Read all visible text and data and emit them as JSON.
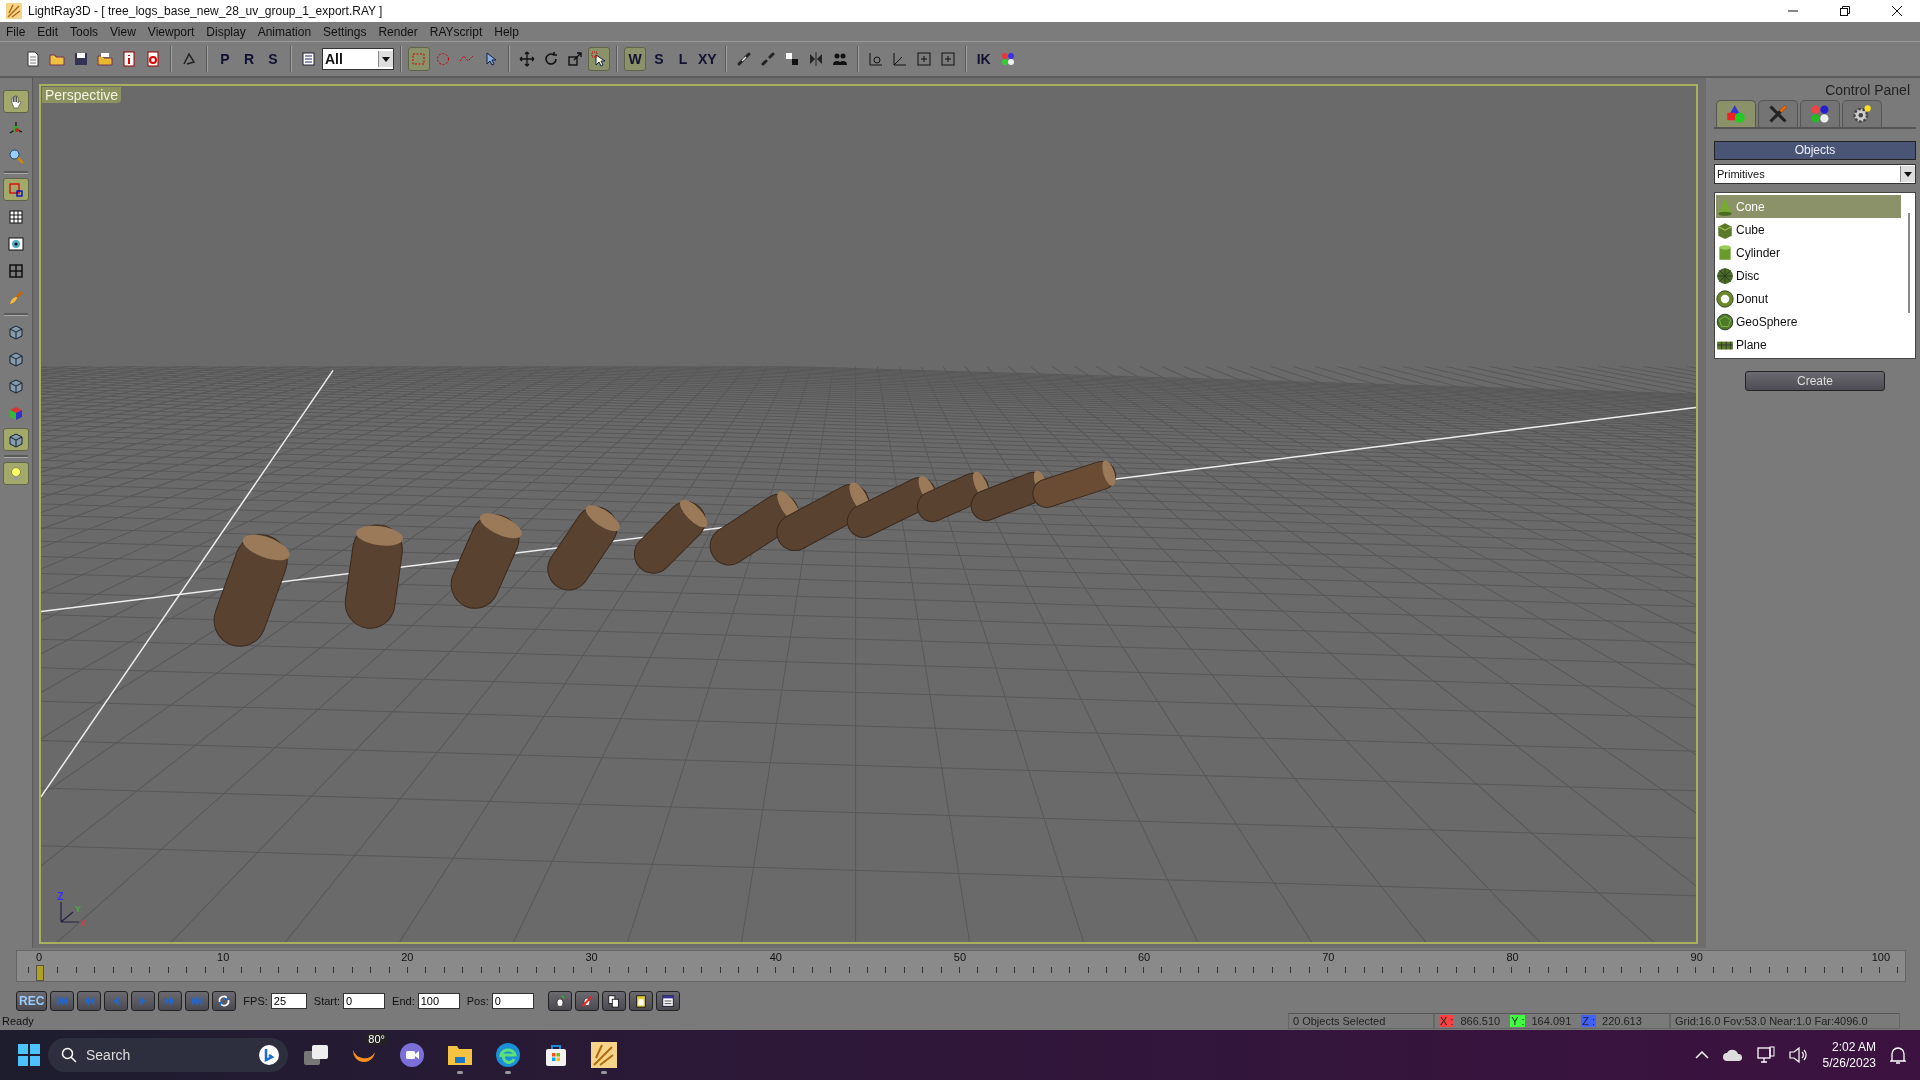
{
  "window": {
    "title": "LightRay3D - [ tree_logs_base_new_28_uv_group_1_export.RAY ]"
  },
  "menu": [
    "File",
    "Edit",
    "Tools",
    "View",
    "Viewport",
    "Display",
    "Animation",
    "Settings",
    "Render",
    "RAYscript",
    "Help"
  ],
  "toolbar": [
    {
      "kind": "new",
      "active": false
    },
    {
      "kind": "open",
      "active": false
    },
    {
      "kind": "save",
      "active": false
    },
    {
      "kind": "folder",
      "active": false
    },
    {
      "kind": "info",
      "active": false
    },
    {
      "kind": "export",
      "active": false
    },
    {
      "kind": "sep"
    },
    {
      "kind": "undo",
      "active": false
    },
    {
      "kind": "sep"
    },
    {
      "kind": "letter",
      "label": "P",
      "active": false
    },
    {
      "kind": "letter",
      "label": "R",
      "active": false
    },
    {
      "kind": "letter",
      "label": "S",
      "active": false
    },
    {
      "kind": "sep"
    },
    {
      "kind": "list",
      "active": false
    },
    {
      "kind": "dropdown",
      "value": "All"
    },
    {
      "kind": "sep"
    },
    {
      "kind": "rect-select",
      "active": true
    },
    {
      "kind": "circle-select",
      "active": false
    },
    {
      "kind": "fence-select",
      "active": false
    },
    {
      "kind": "pointer",
      "active": false
    },
    {
      "kind": "sep"
    },
    {
      "kind": "move",
      "active": false
    },
    {
      "kind": "rotate",
      "active": false
    },
    {
      "kind": "scale",
      "active": false
    },
    {
      "kind": "select-pointer",
      "active": true
    },
    {
      "kind": "sep"
    },
    {
      "kind": "letter",
      "label": "W",
      "active": true
    },
    {
      "kind": "letter",
      "label": "S",
      "active": false
    },
    {
      "kind": "letter",
      "label": "L",
      "active": false
    },
    {
      "kind": "letter",
      "label": "XY",
      "active": false
    },
    {
      "kind": "sep"
    },
    {
      "kind": "link",
      "active": false
    },
    {
      "kind": "unlink",
      "active": false
    },
    {
      "kind": "bind",
      "active": false
    },
    {
      "kind": "mirror",
      "active": false
    },
    {
      "kind": "group",
      "active": false
    },
    {
      "kind": "sep"
    },
    {
      "kind": "snap",
      "active": false
    },
    {
      "kind": "angle",
      "active": false
    },
    {
      "kind": "plus",
      "active": false
    },
    {
      "kind": "plus",
      "active": false
    },
    {
      "kind": "sep"
    },
    {
      "kind": "letter",
      "label": "IK",
      "active": false
    },
    {
      "kind": "colors",
      "active": false
    }
  ],
  "left_toolbar": [
    {
      "kind": "hand",
      "active": true
    },
    {
      "kind": "axes",
      "active": false
    },
    {
      "kind": "zoom",
      "active": false
    },
    {
      "kind": "sep"
    },
    {
      "kind": "region",
      "active": true
    },
    {
      "kind": "grid",
      "active": false
    },
    {
      "kind": "eye",
      "active": false
    },
    {
      "kind": "quad",
      "active": false
    },
    {
      "kind": "brush",
      "active": false
    },
    {
      "kind": "sep"
    },
    {
      "kind": "box",
      "active": false
    },
    {
      "kind": "box",
      "active": false
    },
    {
      "kind": "box",
      "active": false
    },
    {
      "kind": "rgb-box",
      "active": false
    },
    {
      "kind": "box",
      "active": true
    },
    {
      "kind": "sep"
    },
    {
      "kind": "bulb",
      "active": true
    }
  ],
  "viewport": {
    "label": "Perspective",
    "gizmo": [
      "Z",
      "Y",
      "X"
    ]
  },
  "control_panel": {
    "title": "Control Panel",
    "tabs": [
      {
        "kind": "create",
        "selected": true
      },
      {
        "kind": "modify",
        "selected": false
      },
      {
        "kind": "material",
        "selected": false
      },
      {
        "kind": "settings",
        "selected": false
      }
    ],
    "section": "Objects",
    "category": "Primitives",
    "objects": [
      {
        "kind": "cone",
        "label": "Cone",
        "selected": true
      },
      {
        "kind": "cube",
        "label": "Cube",
        "selected": false
      },
      {
        "kind": "cylinder",
        "label": "Cylinder",
        "selected": false
      },
      {
        "kind": "disc",
        "label": "Disc",
        "selected": false
      },
      {
        "kind": "donut",
        "label": "Donut",
        "selected": false
      },
      {
        "kind": "sphere",
        "label": "GeoSphere",
        "selected": false
      },
      {
        "kind": "plane",
        "label": "Plane",
        "selected": false
      }
    ],
    "create_button": "Create"
  },
  "timeline": {
    "ticks": [
      "0",
      "10",
      "20",
      "30",
      "40",
      "50",
      "60",
      "70",
      "80",
      "90",
      "100"
    ],
    "level": 0
  },
  "transport": {
    "buttons": [
      {
        "kind": "rec",
        "label": "REC"
      },
      {
        "kind": "first"
      },
      {
        "kind": "prev-key"
      },
      {
        "kind": "prev"
      },
      {
        "kind": "play"
      },
      {
        "kind": "next-key"
      },
      {
        "kind": "last"
      },
      {
        "kind": "loop"
      }
    ],
    "fields": [
      {
        "label": "FPS:",
        "value": "25"
      },
      {
        "label": "Start:",
        "value": "0"
      },
      {
        "label": "End:",
        "value": "100"
      },
      {
        "label": "Pos:",
        "value": "0"
      }
    ],
    "key_buttons": [
      {
        "kind": "add-key"
      },
      {
        "kind": "delete-key"
      },
      {
        "kind": "copy-key"
      },
      {
        "kind": "paste-key"
      },
      {
        "kind": "key-list"
      }
    ]
  },
  "status": {
    "message": "Ready",
    "selection": "0 Objects Selected",
    "coords": [
      {
        "axis": "X :",
        "value": "866.510",
        "color": "#ff4040"
      },
      {
        "axis": "Y :",
        "value": "164.091",
        "color": "#40ff40"
      },
      {
        "axis": "Z :",
        "value": "220.613",
        "color": "#4060ff"
      }
    ],
    "camera": "Grid:16.0 Fov:53.0 Near:1.0 Far:4096.0"
  },
  "taskbar": {
    "search": {
      "placeholder": "Search"
    },
    "weather": "80°",
    "apps": [
      {
        "kind": "task-view",
        "running": false
      },
      {
        "kind": "weather"
      },
      {
        "kind": "chat",
        "running": false
      },
      {
        "kind": "files",
        "running": true
      },
      {
        "kind": "browser",
        "running": true
      },
      {
        "kind": "store",
        "running": false
      },
      {
        "kind": "lightray",
        "running": true
      }
    ],
    "time": "2:02 AM",
    "date": "5/26/2023"
  }
}
